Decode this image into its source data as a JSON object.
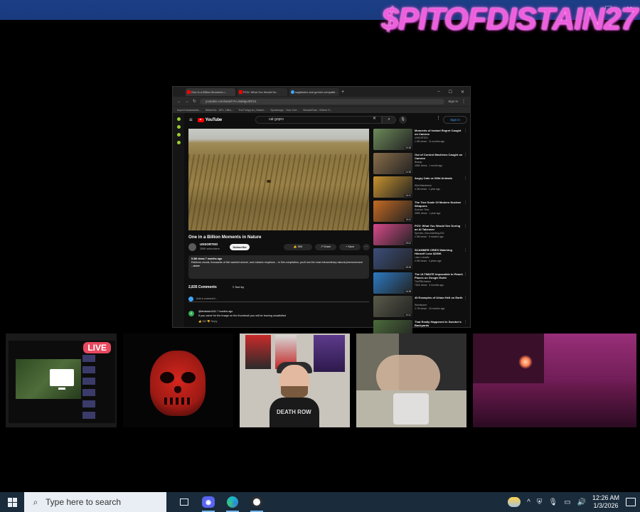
{
  "overlay": {
    "channel_name": "$PITOFDISTAIN27"
  },
  "browser": {
    "tabs": [
      {
        "label": "One in a Billion Moments i..."
      },
      {
        "label": "POV: What You Would Se..."
      },
      {
        "label": "sagittarius and gemini compatib..."
      }
    ],
    "url": "youtube.com/watch?v=8aMgv3RG4",
    "signin_small": "Sign in",
    "bookmarks": [
      "Import bookmarks...",
      "StrikeOut - NFL, NBA,...",
      "TheTVApp.to | Watch...",
      "Sportsurge - Your Out...",
      "StreamEast - Where S..."
    ]
  },
  "youtube": {
    "logo_text": "YouTube",
    "search_query": "cat gopro",
    "sign_in": "Sign in",
    "video_title": "One in a Billion Moments in Nature",
    "channel": "UNSORTED",
    "subscribers": "259K subscribers",
    "subscribe": "Subscribe",
    "likes": "36K",
    "share": "Share",
    "save": "Save",
    "description_meta": "5.3M views 7 months ago",
    "description_text": "Rainbow clouds, thousands of fish washed ashore, and volcanic eruptions -- In this compilation, you'll see the most extraordinary natural phenomenons!",
    "description_more": "...more",
    "comment_count": "2,835 Comments",
    "sort_by": "Sort by",
    "add_comment_placeholder": "Add a comment...",
    "comment": {
      "avatar_letter": "B",
      "author": "@birdsdoe1441  7 months ago",
      "text": "If you came for the image on the thumbnail you will be leaving unsatisfied",
      "likes": "393",
      "reply": "Reply"
    },
    "recommendations": [
      {
        "title": "Moments of Instant Regret Caught on Camera",
        "channel": "UNSORTED",
        "meta": "1.5M views · 11 months ago",
        "duration": "20:38",
        "thumb_color": "#6c8a5a"
      },
      {
        "title": "Out of Control Machines Caught on Camera",
        "channel": "Beasty",
        "meta": "455K views · 1 month ago",
        "duration": "14:38",
        "thumb_color": "#8a6e4a"
      },
      {
        "title": "Angry Cats vs Wild Animals",
        "channel": "Wild Wanderers",
        "meta": "4.3M views · 1 year ago",
        "duration": "16:41",
        "thumb_color": "#c7922f"
      },
      {
        "title": "The True Scale Of Modern Nuclear Weapons",
        "channel": "Science Time",
        "meta": "355K views · 1 year ago",
        "duration": "19:11",
        "thumb_color": "#c46a22"
      },
      {
        "title": "POV: What You Would See During an AI Takeover",
        "channel": "Species | Documenting AGI",
        "meta": "2.5M views · 5 months ago",
        "duration": "29:02",
        "thumb_color": "#d84a8a"
      },
      {
        "title": "SCAMMER CRIES Watching Himself Lose $250K",
        "channel": "Liam Lutowitz",
        "meta": "4.5M views · 4 years ago",
        "duration": "25:35",
        "thumb_color": "#3b4e7a"
      },
      {
        "title": "The ULTIMATE Impossible to Reach Places on Google Earth",
        "channel": "TheFBIUnseen",
        "meta": "762K views · 3 months ago",
        "duration": "16:38",
        "thumb_color": "#2c7ac2"
      },
      {
        "title": "40 Examples of Urban Hell on Earth",
        "channel": "Worldsome",
        "meta": "2.7M views · 10 months ago",
        "duration": "24:11",
        "thumb_color": "#5a5a4a"
      },
      {
        "title": "That Really Happened in Sweden's Backyards",
        "channel": "",
        "meta": "",
        "duration": "",
        "thumb_color": "#4b6b3a"
      }
    ]
  },
  "stream": {
    "live_label": "LIVE",
    "shirt_text": "DEATH ROW"
  },
  "taskbar": {
    "search_placeholder": "Type here to search",
    "time": "12:26 AM",
    "date": "1/3/2026"
  }
}
